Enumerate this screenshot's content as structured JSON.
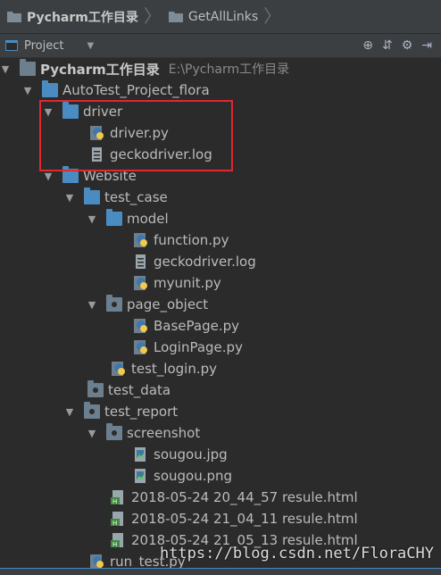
{
  "breadcrumb": {
    "root": "Pycharm工作目录",
    "child": "GetAllLinks"
  },
  "toolbar": {
    "project_label": "Project",
    "dropdown_icon": "chevron-down-icon"
  },
  "tree": {
    "root": {
      "name": "Pycharm工作目录",
      "path": "E:\\Pycharm工作目录"
    },
    "project": "AutoTest_Project_flora",
    "driver": "driver",
    "driver_py": "driver.py",
    "gecko_log": "geckodriver.log",
    "website": "Website",
    "test_case": "test_case",
    "model": "model",
    "function_py": "function.py",
    "gecko_log2": "geckodriver.log",
    "myunit_py": "myunit.py",
    "page_object": "page_object",
    "basepage_py": "BasePage.py",
    "loginpage_py": "LoginPage.py",
    "test_login_py": "test_login.py",
    "test_data": "test_data",
    "test_report": "test_report",
    "screenshot": "screenshot",
    "sougou_jpg": "sougou.jpg",
    "sougou_png": "sougou.png",
    "report1": "2018-05-24 20_44_57 resule.html",
    "report2": "2018-05-24 21_04_11 resule.html",
    "report3": "2018-05-24 21_05_13 resule.html",
    "run_test_py": "run_test.py"
  },
  "watermark": "https://blog.csdn.net/FloraCHY"
}
